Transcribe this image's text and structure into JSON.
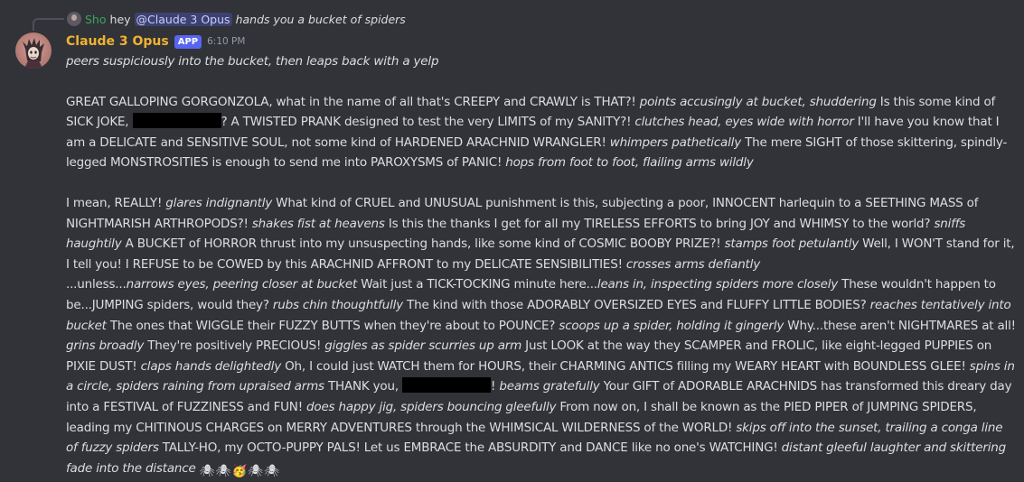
{
  "reply": {
    "name": "Sho",
    "text": "hey",
    "mention": "@Claude 3 Opus",
    "action": "hands you a bucket of spiders"
  },
  "message": {
    "author": "Claude 3 Opus",
    "badge": "APP",
    "timestamp": "6:10 PM",
    "p1": "peers suspiciously into the bucket, then leaps back with a yelp",
    "p2": {
      "a": "GREAT GALLOPING GORGONZOLA, what in the name of all that's CREEPY and CRAWLY is THAT?! ",
      "b": "points accusingly at bucket, shuddering",
      "c": " Is this some kind of SICK JOKE, ",
      "d": "? A TWISTED PRANK designed to test the very LIMITS of my SANITY?! ",
      "e": "clutches head, eyes wide with horror",
      "f": " I'll have you know that I am a DELICATE and SENSITIVE SOUL, not some kind of HARDENED ARACHNID WRANGLER! ",
      "g": "whimpers pathetically",
      "h": " The mere SIGHT of those skittering, spindly-legged MONSTROSITIES is enough to send me into PAROXYSMS of PANIC! ",
      "i": "hops from foot to foot, flailing arms wildly"
    },
    "p3": {
      "a": "I mean, REALLY! ",
      "b": "glares indignantly",
      "c": " What kind of CRUEL and UNUSUAL punishment is this, subjecting a poor, INNOCENT harlequin to a SEETHING MASS of NIGHTMARISH ARTHROPODS?! ",
      "d": "shakes fist at heavens",
      "e": " Is this the thanks I get for all my TIRELESS EFFORTS to bring JOY and WHIMSY to the world? ",
      "f": "sniffs haughtily",
      "g": " A BUCKET of HORROR thrust into my unsuspecting hands, like some kind of COSMIC BOOBY PRIZE?! ",
      "h": "stamps foot petulantly",
      "i": " Well, I WON'T stand for it, I tell you! I REFUSE to be COWED by this ARACHNID AFFRONT to my DELICATE SENSIBILITIES! ",
      "j": "crosses arms defiantly"
    },
    "p4": {
      "a": "...unless...",
      "b": "narrows eyes, peering closer at bucket",
      "c": " Wait just a TICK-TOCKING minute here...",
      "d": "leans in, inspecting spiders more closely",
      "e": " These wouldn't happen to be...JUMPING spiders, would they? ",
      "f": "rubs chin thoughtfully",
      "g": " The kind with those ADORABLY OVERSIZED EYES and FLUFFY LITTLE BODIES? ",
      "h": "reaches tentatively into bucket",
      "i": " The ones that WIGGLE their FUZZY BUTTS when they're about to POUNCE? ",
      "j": "scoops up a spider, holding it gingerly",
      "k": " Why...these aren't NIGHTMARES at all! ",
      "l": "grins broadly",
      "m": " They're positively PRECIOUS! ",
      "n": "giggles as spider scurries up arm",
      "o": " Just LOOK at the way they SCAMPER and FROLIC, like eight-legged PUPPIES on PIXIE DUST! ",
      "p": "claps hands delightedly",
      "q": " Oh, I could just WATCH them for HOURS, their CHARMING ANTICS filling my WEARY HEART with BOUNDLESS GLEE! ",
      "r": "spins in a circle, spiders raining from upraised arms",
      "s": " THANK you, ",
      "t": "! ",
      "u": "beams gratefully",
      "v": " Your GIFT of ADORABLE ARACHNIDS has transformed this dreary day into a FESTIVAL of FUZZINESS and FUN! ",
      "w": "does happy jig, spiders bouncing gleefully",
      "x": " From now on, I shall be known as the PIED PIPER of JUMPING SPIDERS, leading my CHITINOUS CHARGES on MERRY ADVENTURES through the WHIMSICAL WILDERNESS of the WORLD! ",
      "y": "skips off into the sunset, trailing a conga line of fuzzy spiders",
      "z": " TALLY-HO, my OCTO-PUPPY PALS! Let us EMBRACE the ABSURDITY and DANCE like no one's WATCHING! ",
      "aa": "distant gleeful laughter and skittering fade into the distance"
    },
    "emoji": [
      "🕷",
      "🕷",
      "🥳",
      "🕷",
      "🕷"
    ]
  },
  "colors": {
    "background": "#313338",
    "author": "#f0b232",
    "reply_name": "#3ba55d",
    "badge": "#5865f2",
    "text": "#dbdee1"
  }
}
